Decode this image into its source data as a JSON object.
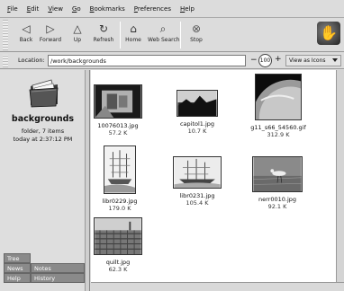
{
  "menu": [
    "File",
    "Edit",
    "View",
    "Go",
    "Bookmarks",
    "Preferences",
    "Help"
  ],
  "toolbar": {
    "back": "Back",
    "forward": "Forward",
    "up": "Up",
    "refresh": "Refresh",
    "home": "Home",
    "web_search": "Web Search",
    "stop": "Stop"
  },
  "location": {
    "label": "Location:",
    "value": "/work/backgrounds"
  },
  "zoom": "100",
  "view_as": "View as Icons",
  "sidebar": {
    "title": "backgrounds",
    "info": "folder, 7 items",
    "date": "today at 2:37:12 PM",
    "tabs": [
      "Tree",
      "News",
      "Notes",
      "Help",
      "History"
    ]
  },
  "files": [
    {
      "name": "10076013.jpg",
      "size": "57.2 K"
    },
    {
      "name": "capitol1.jpg",
      "size": "10.7 K"
    },
    {
      "name": "g11_s66_54560.gif",
      "size": "312.9 K"
    },
    {
      "name": "libr0229.jpg",
      "size": "179.0 K"
    },
    {
      "name": "libr0231.jpg",
      "size": "105.4 K"
    },
    {
      "name": "nerr0010.jpg",
      "size": "92.1 K"
    },
    {
      "name": "quilt.jpg",
      "size": "62.3 K"
    }
  ]
}
